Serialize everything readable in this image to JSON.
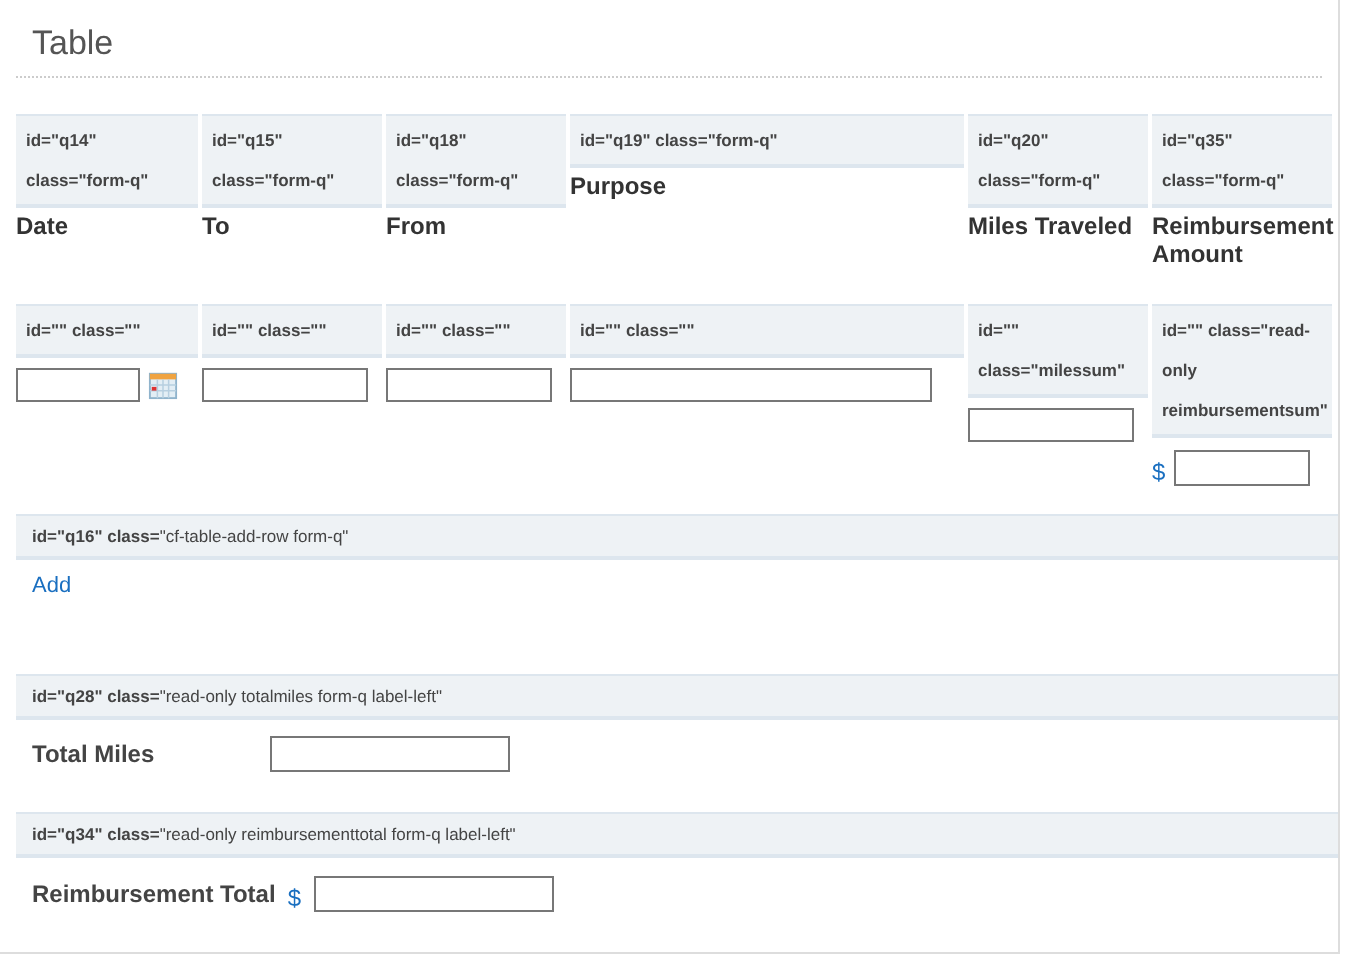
{
  "section_title": "Table",
  "columns": [
    {
      "tag": "id=\"q14\" class=\"form-q\"",
      "label": "Date",
      "cell_tag": "id=\"\" class=\"\"",
      "kind": "date"
    },
    {
      "tag": "id=\"q15\" class=\"form-q\"",
      "label": "To",
      "cell_tag": "id=\"\" class=\"\"",
      "kind": "text"
    },
    {
      "tag": "id=\"q18\" class=\"form-q\"",
      "label": "From",
      "cell_tag": "id=\"\" class=\"\"",
      "kind": "text"
    },
    {
      "tag": "id=\"q19\" class=\"form-q\"",
      "label": "Purpose",
      "cell_tag": "id=\"\" class=\"\"",
      "kind": "text"
    },
    {
      "tag": "id=\"q20\" class=\"form-q\"",
      "label": "Miles Traveled",
      "cell_tag": "id=\"\" class=\"milessum\"",
      "kind": "text"
    },
    {
      "tag": "id=\"q35\" class=\"form-q\"",
      "label": "Reimbursement Amount",
      "cell_tag": "id=\"\" class=\"read-only reimbursementsum\"",
      "kind": "currency",
      "prefix": "$"
    }
  ],
  "add_row": {
    "tag": "**id=\"q16\" class=**\"cf-table-add-row form-q\"",
    "link": "Add"
  },
  "totals": [
    {
      "tag": "**id=\"q28\" class=**\"read-only totalmiles form-q label-left\"",
      "label": "Total Miles",
      "kind": "text"
    },
    {
      "tag": "**id=\"q34\" class=**\"read-only reimbursementtotal form-q label-left\"",
      "label": "Reimbursement Total",
      "kind": "currency",
      "prefix": "$"
    }
  ]
}
